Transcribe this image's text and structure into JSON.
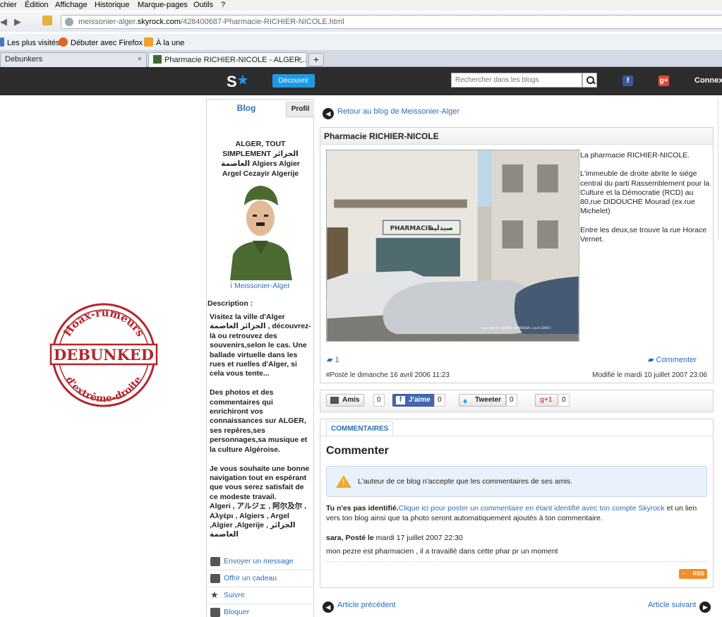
{
  "browser": {
    "menu": [
      "chier",
      "Édition",
      "Affichage",
      "Historique",
      "Marque-pages",
      "Outils",
      "?"
    ],
    "url_prefix": "meissonier-alger.",
    "url_domain": "skyrock.com",
    "url_path": "/428400687-Pharmacie-RICHIER-NICOLE.html",
    "bookmarks": [
      "Les plus visités",
      "Débuter avec Firefox",
      "À la une"
    ],
    "tabs": [
      {
        "label": "Debunkers",
        "close": "×"
      },
      {
        "label": "Pharmacie RICHIER-NICOLE - ALGER,...",
        "close": "×"
      }
    ],
    "new_tab": "+"
  },
  "site": {
    "logo": "S",
    "discover": "Découvrir",
    "search_placeholder": "Rechercher dans les blogs",
    "fb": "f",
    "gplus": "g+",
    "connect": "Connexion"
  },
  "stamp": {
    "top": "Hoax-rumeurs",
    "middle": "DEBUNKED",
    "bottom": "d'extrême-droite"
  },
  "sidebar": {
    "tab_blog": "Blog",
    "tab_profil": "Profil",
    "blog_title": "ALGER, TOUT SIMPLEMENT الجزائر العاصمة Algiers Algier Argel Cezayir Algerije",
    "author": "Meissonier-Alger",
    "description_label": "Description :",
    "description": "Visitez la ville d'Alger الجزائر العاصمة , découvrez-là ou retrouvez des souvenirs,selon le cas. Une ballade virtuelle dans les rues et ruelles d'Alger, si cela vous tente...\n\nDes photos et des commentaires qui enrichiront vos connaissances sur ALGER, ses repères,ses personnages,sa musique et la culture Algéroise.\n\nJe vous souhaite une bonne navigation tout en espérant que vous serez satisfait de ce modeste travail.\nAlgeri , アルジェ , 阿尔及尔 , Αλγέρι , Algiers , Argel ,Algier ,Algerije , الجزائر العاصمة",
    "actions": [
      "Envoyer un message",
      "Offrir un cadeau",
      "Suivre",
      "Bloquer"
    ]
  },
  "article": {
    "back_link": "Retour au blog de Meissonier-Alger",
    "title": "Pharmacie RICHIER-NICOLE",
    "text": "La pharmacie RICHIER-NICOLE.\n\nL'immeuble de droite abrite le siége central du parti Rassemblement pour la Culture et la Démocratie (RCD) au 80,rue DIDOUCHE Mourad (ex.rue Michelet)\n\nEntre les deux,se trouve la rue Horace Vernet.",
    "photo_sign_latin": "PHARMACIE",
    "photo_sign_arabic": "صيدلية",
    "photo_credit": "copyright © DJAMAL HAMOUDA ( avril 2006 )",
    "comment_count": "1",
    "comment_link": "Commenter",
    "posted": "#Posté le dimanche 16 avril 2006 11:23",
    "modified": "Modifié le mardi 10 juillet 2007 23:06"
  },
  "share": {
    "amis": "Amis",
    "amis_count": "0",
    "like": "J'aime",
    "like_count": "0",
    "tweet": "Tweeter",
    "tweet_count": "0",
    "gplus": "+1",
    "gplus_count": "0"
  },
  "comments": {
    "tab": "COMMENTAIRES",
    "heading": "Commenter",
    "notice": "L'auteur de ce blog n'accepte que les commentaires de ses amis.",
    "not_identified": "Tu n'es pas identifié.",
    "identify_link": "Clique ici pour poster un commentaire en étant identifié avec ton compte Skyrock",
    "identify_rest": " et un lien vers ton blog ainsi que ta photo seront automatiquement ajoutés à ton commentaire.",
    "author_line": "sara, Posté le",
    "date": " mardi 17 juillet 2007 22:30",
    "body": "mon pezre est pharmacien , il a travaillé dans cette phar pr un moment",
    "rss": "RSS"
  },
  "nav": {
    "prev": "Article précédent",
    "next": "Article suivant"
  }
}
